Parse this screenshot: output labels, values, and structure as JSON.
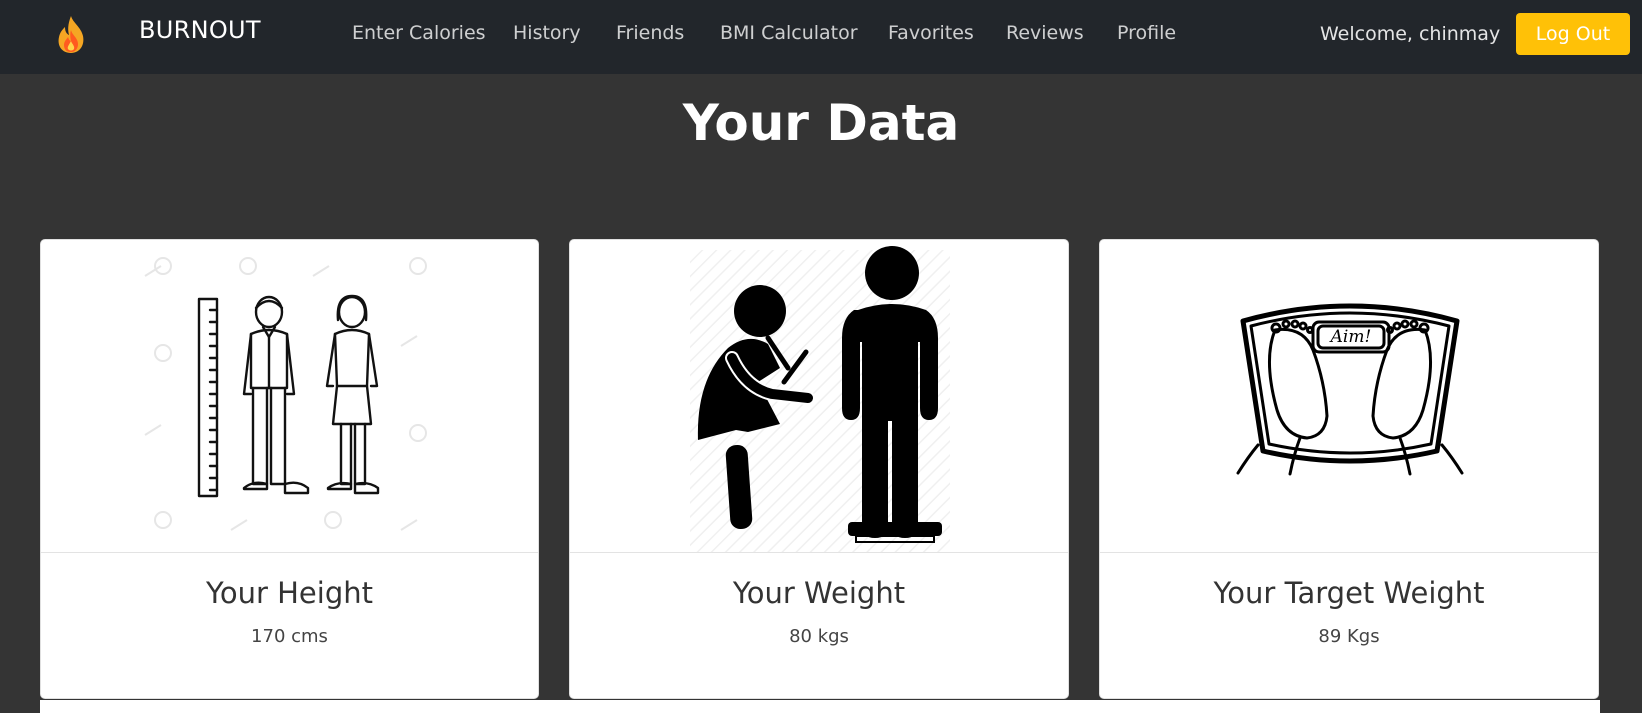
{
  "brand": {
    "name": "BURNOUT",
    "logo_icon": "flame-icon"
  },
  "nav": {
    "items": [
      {
        "label": "Enter Calories"
      },
      {
        "label": "History"
      },
      {
        "label": "Friends"
      },
      {
        "label": "BMI Calculator"
      },
      {
        "label": "Favorites"
      },
      {
        "label": "Reviews"
      },
      {
        "label": "Profile"
      }
    ],
    "welcome": "Welcome, chinmay",
    "logout_label": "Log Out"
  },
  "page": {
    "title": "Your Data"
  },
  "cards": [
    {
      "title": "Your Height",
      "value": "170 cms",
      "image": "height-chart-icon"
    },
    {
      "title": "Your Weight",
      "value": "80 kgs",
      "image": "weight-measurement-icon"
    },
    {
      "title": "Your Target Weight",
      "value": "89 Kgs",
      "image": "bathroom-scale-icon"
    }
  ],
  "colors": {
    "navbar": "#22262b",
    "background": "#343434",
    "accent": "#ffc107"
  }
}
